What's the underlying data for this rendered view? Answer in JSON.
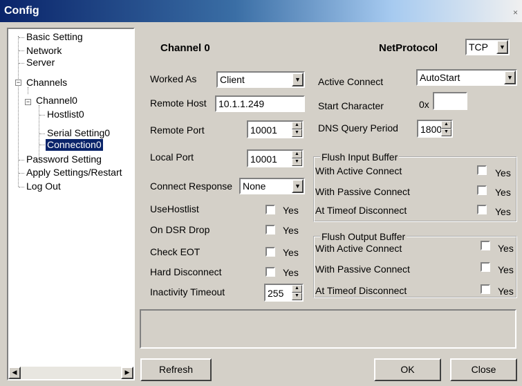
{
  "window": {
    "title": "Config",
    "close_glyph": "×"
  },
  "tree": {
    "items": [
      {
        "label": "Basic Setting"
      },
      {
        "label": "Network"
      },
      {
        "label": "Server"
      },
      {
        "label": "Channels",
        "expander": "−"
      },
      {
        "label": "Channel0",
        "expander": "−"
      },
      {
        "label": "Hostlist0"
      },
      {
        "label": "Serial Setting0"
      },
      {
        "label": "Connection0",
        "selected": true
      },
      {
        "label": "Password Setting"
      },
      {
        "label": "Apply Settings/Restart"
      },
      {
        "label": "Log Out"
      }
    ]
  },
  "channel": {
    "title": "Channel 0",
    "net_protocol_label": "NetProtocol",
    "net_protocol_value": "TCP"
  },
  "left_fields": {
    "worked_as_label": "Worked As",
    "worked_as_value": "Client",
    "remote_host_label": "Remote Host",
    "remote_host_value": "10.1.1.249",
    "remote_port_label": "Remote Port",
    "remote_port_value": "10001",
    "local_port_label": "Local Port",
    "local_port_value": "10001",
    "connect_response_label": "Connect Response",
    "connect_response_value": "None",
    "use_hostlist_label": "UseHostlist",
    "on_dsr_drop_label": "On DSR Drop",
    "check_eot_label": "Check EOT",
    "hard_disconnect_label": "Hard Disconnect",
    "inactivity_timeout_label": "Inactivity Timeout",
    "inactivity_timeout_value": "255",
    "yes_label": "Yes"
  },
  "right_fields": {
    "active_connect_label": "Active Connect",
    "active_connect_value": "AutoStart",
    "start_character_label": "Start Character",
    "start_character_prefix": "0x",
    "start_character_value": "",
    "dns_query_label": "DNS Query Period",
    "dns_query_value": "1800"
  },
  "flush_input": {
    "legend": "Flush Input Buffer",
    "rows": [
      "With Active Connect",
      "With Passive Connect",
      "At Timeof Disconnect"
    ]
  },
  "flush_output": {
    "legend": "Flush Output Buffer",
    "rows": [
      "With Active Connect",
      "With Passive Connect",
      "At Timeof Disconnect"
    ]
  },
  "buttons": {
    "refresh": "Refresh",
    "ok": "OK",
    "close": "Close"
  },
  "icons": {
    "combo": "▼",
    "spin_up": "▲",
    "spin_down": "▼",
    "scroll_left": "◀",
    "scroll_right": "▶"
  },
  "colors": {
    "selection": "#0a246a",
    "titlebar": "#0a246a",
    "face": "#d4d0c8"
  }
}
